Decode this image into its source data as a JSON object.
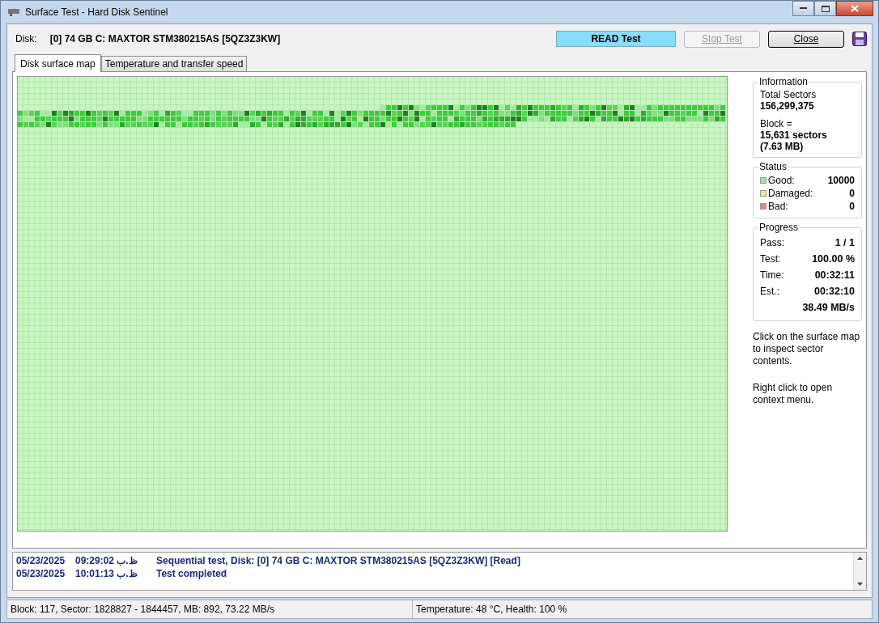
{
  "window": {
    "title": "Surface Test - Hard Disk Sentinel"
  },
  "disk": {
    "label": "Disk:",
    "value": "[0] 74 GB C: MAXTOR STM380215AS [5QZ3Z3KW]"
  },
  "mode_label": "READ Test",
  "buttons": [
    {
      "label": "Stop Test",
      "disabled": true
    },
    {
      "label": "Close",
      "disabled": false
    }
  ],
  "tabs": [
    {
      "label": "Disk surface map",
      "selected": true
    },
    {
      "label": "Temperature and transfer speed",
      "selected": false
    }
  ],
  "information": {
    "title": "Information",
    "total_label": "Total Sectors",
    "total_value": "156,299,375",
    "block_label": "Block =",
    "block_sectors": "15,631 sectors",
    "block_size": "(7.63 MB)"
  },
  "status": {
    "title": "Status",
    "items": [
      {
        "label": "Good:",
        "value": "10000",
        "color": "#a8d8a8"
      },
      {
        "label": "Damaged:",
        "value": "0",
        "color": "#e8e890"
      },
      {
        "label": "Bad:",
        "value": "0",
        "color": "#e08888"
      }
    ]
  },
  "progress": {
    "title": "Progress",
    "items": [
      {
        "label": "Pass:",
        "value": "1 / 1"
      },
      {
        "label": "Test:",
        "value": "100.00 %"
      },
      {
        "label": "Time:",
        "value": "00:32:11"
      },
      {
        "label": "Est.:",
        "value": "00:32:10"
      }
    ],
    "speed": "38.49 MB/s"
  },
  "hints": [
    "Click on the surface map to inspect sector contents.",
    "Right click to open context menu."
  ],
  "log": [
    {
      "date": "05/23/2025",
      "time": "09:29:02 ب.ظ",
      "message": "Sequential test, Disk: [0] 74 GB C: MAXTOR STM380215AS [5QZ3Z3KW] [Read]"
    },
    {
      "date": "05/23/2025",
      "time": "10:01:13 ب.ظ",
      "message": "Test completed"
    }
  ],
  "status_bar": [
    "Block: 117, Sector: 1828827 - 1844457, MB: 892, 73.22 MB/s",
    "Temperature: 48  °C,  Health: 100 %"
  ]
}
